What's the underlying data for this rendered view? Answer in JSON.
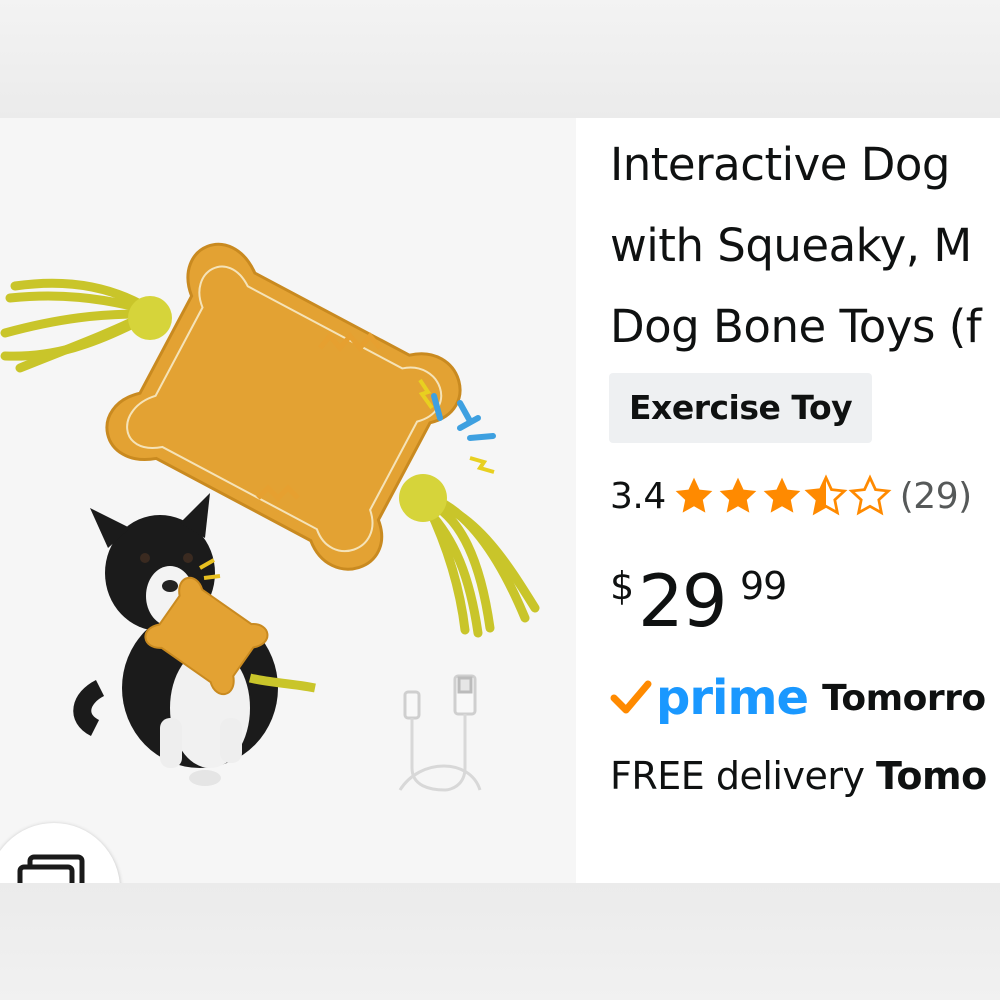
{
  "product": {
    "title_lines": [
      "Interactive Dog",
      "with Squeaky, M",
      "Dog Bone Toys (f"
    ],
    "variant_label": "Exercise Toy",
    "rating": {
      "value": "3.4",
      "stars": 3.4,
      "count_text": "(29)"
    },
    "price": {
      "symbol": "$",
      "whole": "29",
      "fraction": "99"
    },
    "prime": {
      "word": "prime",
      "day": "Tomorro"
    },
    "delivery": {
      "prefix": "FREE delivery",
      "day": "Tomo"
    }
  },
  "colors": {
    "star": "#ff8a00",
    "prime_blue": "#1a98ff",
    "prime_check": "#ff8a00",
    "text": "#0f1111",
    "secondary_text": "#565959",
    "variant_bg": "#eef0f2"
  },
  "icons": {
    "gallery": "image-stack-icon",
    "star": "star-icon",
    "prime_check": "prime-check-icon"
  }
}
